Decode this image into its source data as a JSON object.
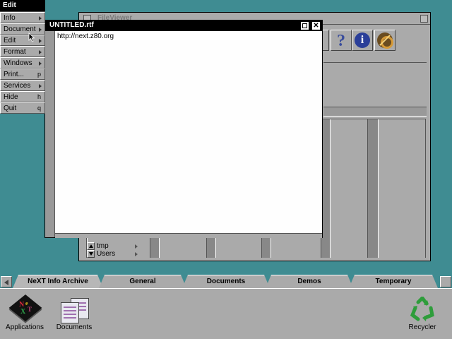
{
  "menu": {
    "title": "Edit",
    "items": [
      {
        "label": "Info",
        "key": "",
        "submenu": true
      },
      {
        "label": "Document",
        "key": "",
        "submenu": true
      },
      {
        "label": "Edit",
        "key": "",
        "submenu": true
      },
      {
        "label": "Format",
        "key": "",
        "submenu": true
      },
      {
        "label": "Windows",
        "key": "",
        "submenu": true
      },
      {
        "label": "Print...",
        "key": "p",
        "submenu": false
      },
      {
        "label": "Services",
        "key": "",
        "submenu": true
      },
      {
        "label": "Hide",
        "key": "h",
        "submenu": false
      },
      {
        "label": "Quit",
        "key": "q",
        "submenu": false
      }
    ]
  },
  "file_viewer": {
    "title": "FileViewer",
    "toolbar": {
      "help": "?",
      "info": "i"
    },
    "list": [
      "tmp",
      "Users"
    ]
  },
  "edit_window": {
    "title": "UNTITLED.rtf",
    "close_glyph": "✕",
    "content": "http://next.z80.org"
  },
  "shelf": {
    "tabs": [
      "NeXT Info Archive",
      "General",
      "Documents",
      "Demos",
      "Temporary"
    ],
    "active_tab": "NeXT Info Archive",
    "icons": {
      "applications": "Applications",
      "documents": "Documents",
      "recycler": "Recycler"
    },
    "next_logo_letters": "NeXT"
  },
  "colors": {
    "desktop": "#3f8c92",
    "window_gray": "#aaaaaa",
    "titlebar_active": "#000000",
    "recycler_green": "#2e9d3b",
    "info_blue": "#2b3f99"
  }
}
